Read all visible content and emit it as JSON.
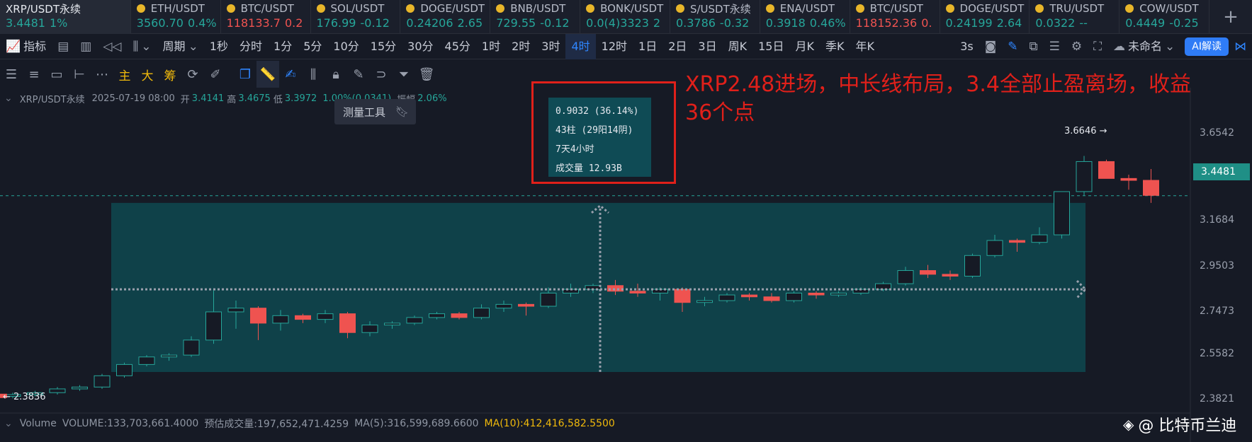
{
  "tickers": [
    {
      "name": "XRP/USDT永续",
      "price": "3.4481",
      "change": "1%",
      "dir": "up"
    },
    {
      "name": "ETH/USDT",
      "price": "3560.70",
      "change": "0.4%",
      "dir": "up"
    },
    {
      "name": "BTC/USDT",
      "price": "118133.7",
      "change": "0.2",
      "dir": "down"
    },
    {
      "name": "SOL/USDT",
      "price": "176.99",
      "change": "-0.12",
      "dir": "up"
    },
    {
      "name": "DOGE/USDT",
      "price": "0.24206",
      "change": "2.65",
      "dir": "up"
    },
    {
      "name": "BNB/USDT",
      "price": "729.55",
      "change": "-0.12",
      "dir": "up"
    },
    {
      "name": "BONK/USDT",
      "price": "0.0(4)3323",
      "change": "2",
      "dir": "up"
    },
    {
      "name": "S/USDT永续",
      "price": "0.3786",
      "change": "-0.32",
      "dir": "up"
    },
    {
      "name": "ENA/USDT",
      "price": "0.3918",
      "change": "0.46%",
      "dir": "up"
    },
    {
      "name": "BTC/USDT",
      "price": "118152.36",
      "change": "0.",
      "dir": "down"
    },
    {
      "name": "DOGE/USDT",
      "price": "0.24199",
      "change": "2.64",
      "dir": "up"
    },
    {
      "name": "TRU/USDT",
      "price": "0.0322",
      "change": "--",
      "dir": "up"
    },
    {
      "name": "COW/USDT",
      "price": "0.4449",
      "change": "-0.25",
      "dir": "up"
    }
  ],
  "period_bar": {
    "indicators": "指标",
    "period": "周期",
    "items": [
      "1秒",
      "分时",
      "1分",
      "5分",
      "10分",
      "15分",
      "30分",
      "45分",
      "1时",
      "2时",
      "3时",
      "4时",
      "12时",
      "1日",
      "2日",
      "3日",
      "周K",
      "15日",
      "月K",
      "季K",
      "年K"
    ],
    "active": "4时",
    "interval": "3s",
    "layout_name": "未命名",
    "ai_button": "AI解读"
  },
  "draw_bar": {
    "gold_items": [
      "主",
      "大",
      "筹"
    ]
  },
  "tooltip": {
    "label": "测量工具"
  },
  "info_line": {
    "symbol": "XRP/USDT永续",
    "datetime": "2025-07-19 08:00",
    "open_label": "开",
    "open": "3.4141",
    "high_label": "高",
    "high": "3.4675",
    "low_label": "低",
    "low": "3.3972",
    "change": "1.00%(0.0341)",
    "amp_label": "振幅",
    "amp": "2.06%"
  },
  "measure": {
    "line1": "0.9032 (36.14%)",
    "line2": "43柱 (29阳14阴)",
    "line3": "7天4小时",
    "line4": "成交量 12.93B"
  },
  "annotation": {
    "line1": "XRP2.48进场，中长线布局，3.4全部止盈离场，收益",
    "line2": "36个点"
  },
  "price_axis": {
    "labels": [
      "3.6542",
      "3.4481",
      "3.1684",
      "2.9503",
      "2.7473",
      "2.5582",
      "2.3821"
    ],
    "current": "3.4481",
    "high_marker": "3.6646 →",
    "low_marker": "← 2.3836"
  },
  "volume": {
    "label": "Volume",
    "vol": "VOLUME:133,703,661.4000",
    "est": "预估成交量:197,652,471.4259",
    "ma5": "MA(5):316,599,689.6600",
    "ma10": "MA(10):412,416,582.5500"
  },
  "watermark": "@ 比特币兰迪",
  "colors": {
    "up": "#26a69a",
    "down": "#ef5350",
    "accent": "#2f86ff",
    "annotation": "#e0201a"
  },
  "chart_data": {
    "type": "candlestick",
    "series": [
      {
        "ohlc": [
          [
            2.38,
            2.4,
            2.37,
            2.39
          ],
          [
            2.39,
            2.41,
            2.38,
            2.4
          ],
          [
            2.4,
            2.43,
            2.39,
            2.42
          ],
          [
            2.42,
            2.44,
            2.41,
            2.43
          ],
          [
            2.43,
            2.5,
            2.42,
            2.49
          ],
          [
            2.49,
            2.56,
            2.48,
            2.55
          ],
          [
            2.55,
            2.6,
            2.54,
            2.59
          ],
          [
            2.59,
            2.61,
            2.57,
            2.6
          ],
          [
            2.6,
            2.7,
            2.59,
            2.68
          ],
          [
            2.68,
            2.95,
            2.66,
            2.83
          ],
          [
            2.83,
            2.89,
            2.74,
            2.85
          ],
          [
            2.85,
            2.86,
            2.68,
            2.77
          ],
          [
            2.77,
            2.84,
            2.73,
            2.81
          ],
          [
            2.81,
            2.82,
            2.77,
            2.79
          ],
          [
            2.79,
            2.84,
            2.77,
            2.82
          ],
          [
            2.82,
            2.83,
            2.69,
            2.72
          ],
          [
            2.72,
            2.78,
            2.7,
            2.76
          ],
          [
            2.76,
            2.78,
            2.74,
            2.77
          ],
          [
            2.77,
            2.81,
            2.76,
            2.8
          ],
          [
            2.8,
            2.83,
            2.79,
            2.82
          ],
          [
            2.82,
            2.83,
            2.79,
            2.8
          ],
          [
            2.8,
            2.87,
            2.79,
            2.85
          ],
          [
            2.85,
            2.89,
            2.83,
            2.87
          ],
          [
            2.87,
            2.88,
            2.81,
            2.86
          ],
          [
            2.86,
            2.96,
            2.85,
            2.93
          ],
          [
            2.93,
            2.98,
            2.91,
            2.95
          ],
          [
            2.95,
            2.98,
            2.93,
            2.97
          ],
          [
            2.97,
            3.0,
            2.92,
            2.94
          ],
          [
            2.94,
            2.98,
            2.91,
            2.93
          ],
          [
            2.93,
            2.96,
            2.89,
            2.95
          ],
          [
            2.95,
            2.96,
            2.83,
            2.88
          ],
          [
            2.88,
            2.91,
            2.86,
            2.89
          ],
          [
            2.89,
            2.93,
            2.88,
            2.92
          ],
          [
            2.92,
            2.93,
            2.89,
            2.91
          ],
          [
            2.91,
            2.93,
            2.88,
            2.89
          ],
          [
            2.89,
            2.94,
            2.88,
            2.93
          ],
          [
            2.93,
            2.94,
            2.9,
            2.92
          ],
          [
            2.92,
            2.94,
            2.91,
            2.93
          ],
          [
            2.93,
            2.96,
            2.92,
            2.95
          ],
          [
            2.95,
            2.99,
            2.94,
            2.98
          ],
          [
            2.98,
            3.07,
            2.97,
            3.05
          ],
          [
            3.05,
            3.08,
            3.01,
            3.03
          ],
          [
            3.03,
            3.05,
            3.0,
            3.02
          ],
          [
            3.02,
            3.14,
            3.01,
            3.13
          ],
          [
            3.13,
            3.24,
            3.12,
            3.21
          ],
          [
            3.21,
            3.22,
            3.15,
            3.2
          ],
          [
            3.2,
            3.28,
            3.19,
            3.24
          ],
          [
            3.24,
            3.39,
            3.22,
            3.47
          ],
          [
            3.47,
            3.66,
            3.45,
            3.63
          ],
          [
            3.63,
            3.64,
            3.54,
            3.54
          ],
          [
            3.54,
            3.56,
            3.48,
            3.53
          ],
          [
            3.53,
            3.59,
            3.41,
            3.45
          ]
        ]
      }
    ],
    "measure_range": {
      "from": 2.51,
      "to": 3.41
    }
  }
}
